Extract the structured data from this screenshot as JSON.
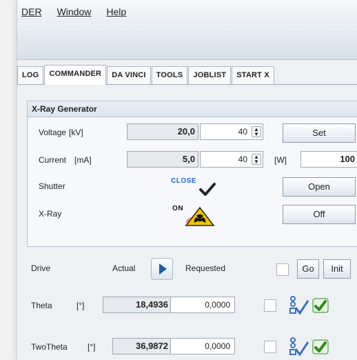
{
  "menu": {
    "item1": "DER",
    "item2": "Window",
    "item3": "Help"
  },
  "tabs": [
    {
      "label": "LOG"
    },
    {
      "label": "COMMANDER"
    },
    {
      "label": "DA VINCI"
    },
    {
      "label": "TOOLS"
    },
    {
      "label": "JOBLIST"
    },
    {
      "label": "START X"
    }
  ],
  "xray": {
    "title": "X-Ray Generator",
    "voltage": {
      "label": "Voltage",
      "unit": "[kV]",
      "actual": "20,0",
      "set": "40",
      "button": "Set"
    },
    "current": {
      "label": "Current",
      "unit": "[mA]",
      "actual": "5,0",
      "set": "40",
      "power_unit": "[W]",
      "power": "100"
    },
    "shutter": {
      "label": "Shutter",
      "status": "CLOSE",
      "button": "Open"
    },
    "xray": {
      "label": "X-Ray",
      "status": "ON",
      "button": "Off"
    }
  },
  "drive": {
    "label": "Drive",
    "actual_label": "Actual",
    "requested_label": "Requested",
    "go_label": "Go",
    "init_label": "Init",
    "rows": [
      {
        "name": "Theta",
        "unit": "[°]",
        "actual": "18,4936",
        "requested": "0,0000"
      },
      {
        "name": "TwoTheta",
        "unit": "[°]",
        "actual": "36,9872",
        "requested": "0,0000"
      }
    ]
  },
  "colors": {
    "accent": "#2a63d9",
    "warning": "#f2c200",
    "danger": "#e01e1e",
    "success": "#2e8b1f"
  },
  "icons": [
    "play-icon",
    "checkmark-icon",
    "radiation-icon",
    "sequence-icon"
  ]
}
